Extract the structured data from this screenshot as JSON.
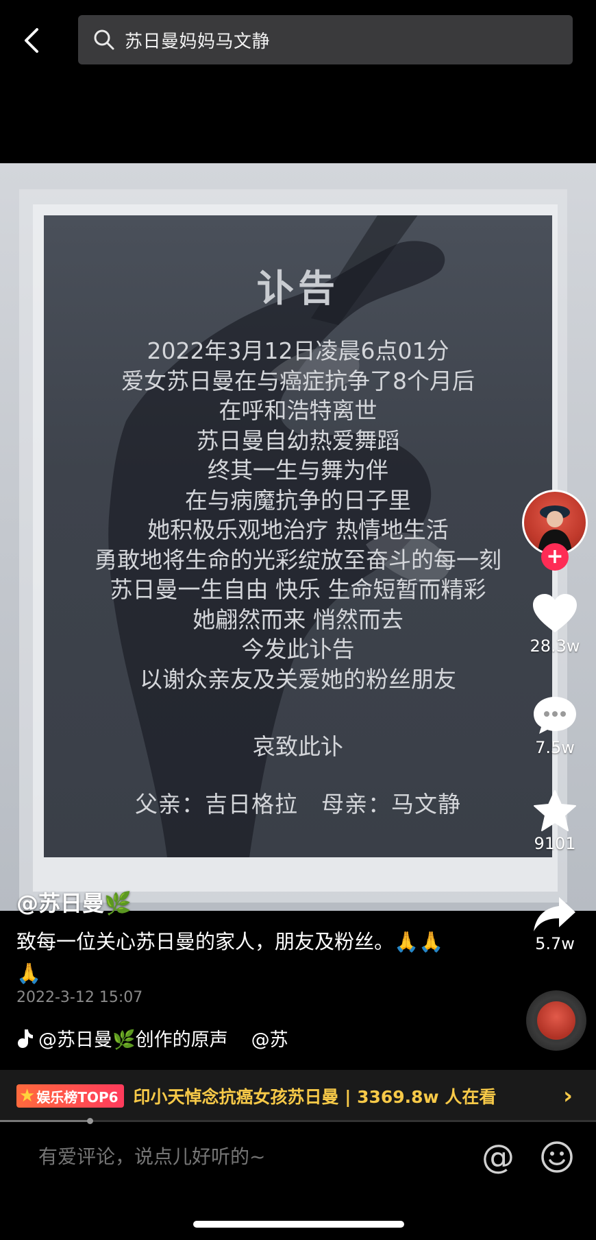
{
  "search": {
    "query": "苏日曼妈妈马文静"
  },
  "notice": {
    "title": "讣告",
    "lines": [
      "2022年3月12日凌晨6点01分",
      "爱女苏日曼在与癌症抗争了8个月后",
      "在呼和浩特离世",
      "苏日曼自幼热爱舞蹈",
      "终其一生与舞为伴",
      "在与病魔抗争的日子里",
      "她积极乐观地治疗 热情地生活",
      "勇敢地将生命的光彩绽放至奋斗的每一刻",
      "苏日曼一生自由 快乐 生命短暂而精彩",
      "她翩然而来 悄然而去",
      "今发此讣告",
      "以谢众亲友及关爱她的粉丝朋友"
    ],
    "closing": "哀致此讣",
    "signature": "父亲：吉日格拉　母亲：马文静"
  },
  "actions": {
    "follow_symbol": "+",
    "likes": "28.3w",
    "comments": "7.5w",
    "favorites": "9101",
    "shares": "5.7w"
  },
  "post": {
    "author": "@苏日曼🌿",
    "caption": "致每一位关心苏日曼的家人，朋友及粉丝。🙏🙏🙏",
    "timestamp": "2022-3-12 15:07",
    "music_title": "@苏日曼🌿创作的原声",
    "music_mention": "@苏"
  },
  "hot": {
    "badge_star": "★",
    "badge_label": "娱乐榜TOP6",
    "title": "印小天悼念抗癌女孩苏日曼 | 3369.8w 人在看",
    "arrow": "›"
  },
  "video_progress": 0.15,
  "comment": {
    "placeholder": "有爱评论，说点儿好听的~",
    "at_symbol": "@"
  },
  "colors": {
    "accent_pink": "#fe2c55",
    "hot_yellow": "#f7c948",
    "background": "#000000"
  },
  "icons": [
    "back-arrow-icon",
    "search-icon",
    "heart-icon",
    "comment-icon",
    "star-icon",
    "share-icon",
    "music-note-icon",
    "emoji-icon"
  ]
}
